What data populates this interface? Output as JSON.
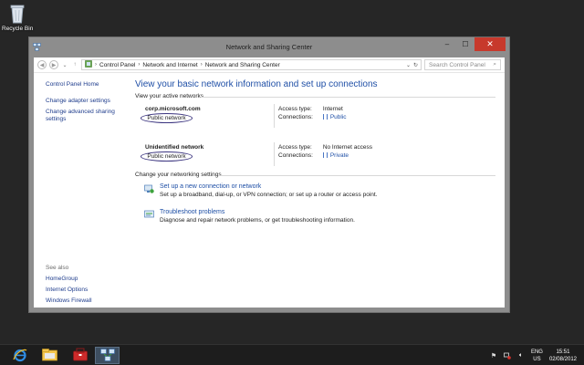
{
  "desktop": {
    "recycle_bin_label": "Recycle Bin"
  },
  "window": {
    "title": "Network and Sharing Center",
    "minimize": "–",
    "maximize": "☐",
    "close": "✕"
  },
  "address": {
    "crumbs": [
      "Control Panel",
      "Network and Internet",
      "Network and Sharing Center"
    ],
    "search_placeholder": "Search Control Panel"
  },
  "sidebar": {
    "home": "Control Panel Home",
    "links": [
      "Change adapter settings",
      "Change advanced sharing settings"
    ],
    "see_also_heading": "See also",
    "see_also": [
      "HomeGroup",
      "Internet Options",
      "Windows Firewall"
    ]
  },
  "main": {
    "title": "View your basic network information and set up connections",
    "active_networks_heading": "View your active networks",
    "networks": [
      {
        "name": "corp.microsoft.com",
        "category": "Public network",
        "access_label": "Access type:",
        "access_value": "Internet",
        "connections_label": "Connections:",
        "connection": "Public"
      },
      {
        "name": "Unidentified network",
        "category": "Public network",
        "access_label": "Access type:",
        "access_value": "No Internet access",
        "connections_label": "Connections:",
        "connection": "Private"
      }
    ],
    "change_settings_heading": "Change your networking settings",
    "tasks": [
      {
        "link": "Set up a new connection or network",
        "desc": "Set up a broadband, dial-up, or VPN connection; or set up a router or access point."
      },
      {
        "link": "Troubleshoot problems",
        "desc": "Diagnose and repair network problems, or get troubleshooting information."
      }
    ]
  },
  "taskbar": {
    "lang_top": "ENG",
    "lang_bottom": "US",
    "time": "15:51",
    "date": "02/08/2012"
  },
  "colors": {
    "accent_link": "#1e4fa6",
    "close_button": "#c7392c",
    "desktop": "#262626"
  }
}
